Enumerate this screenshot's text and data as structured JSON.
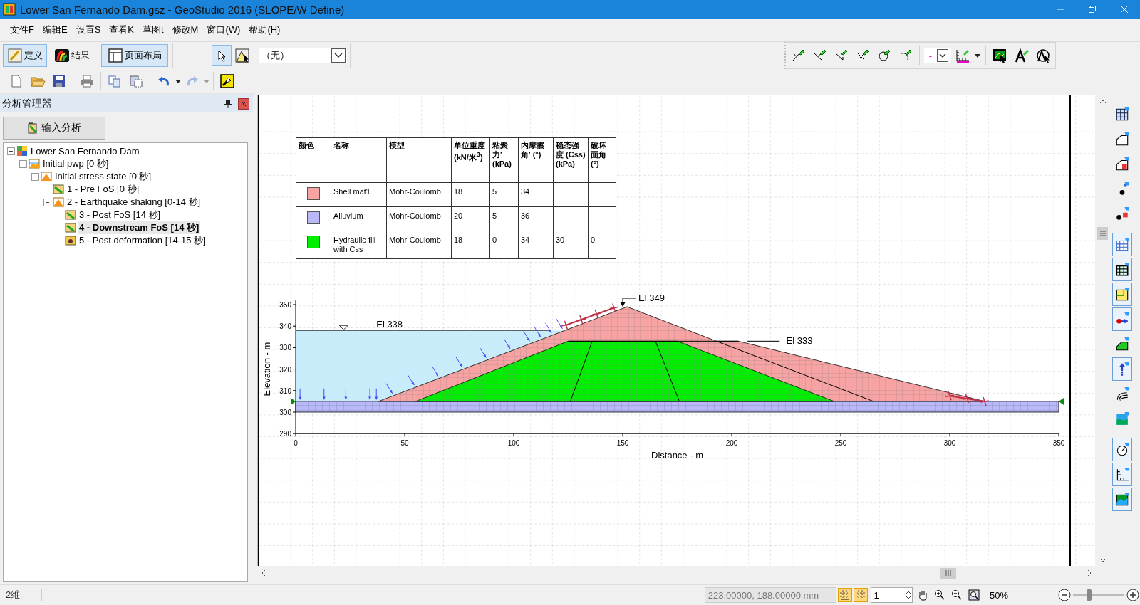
{
  "window": {
    "title": "Lower San Fernando Dam.gsz - GeoStudio 2016 (SLOPE/W Define)"
  },
  "menu": [
    "文件F",
    "编辑E",
    "设置S",
    "查看K",
    "草图t",
    "修改M",
    "窗口(W)",
    "帮助(H)"
  ],
  "mode_buttons": [
    {
      "label": "定义",
      "selected": true
    },
    {
      "label": "结果",
      "selected": false
    },
    {
      "label": "页面布局",
      "selected": true
    }
  ],
  "select_tools": [
    {
      "selected": true
    },
    {
      "selected": false
    }
  ],
  "view_dropdown": {
    "value": "（无）"
  },
  "line_style_dropdown": {
    "value": "-"
  },
  "history": {
    "undo_disabled": false,
    "redo_disabled": true
  },
  "analysis_panel": {
    "title": "分析管理器",
    "add_button": "输入分析",
    "tree": [
      {
        "label": "Lower San Fernando Dam",
        "kind": "project",
        "selected": false,
        "expanded": true,
        "children": [
          {
            "label": "Initial pwp [0 秒]",
            "kind": "pwp",
            "selected": false,
            "expanded": true,
            "children": [
              {
                "label": "Initial stress state [0 秒]",
                "kind": "stress",
                "selected": false,
                "expanded": true,
                "children": [
                  {
                    "label": "1 - Pre FoS [0 秒]",
                    "kind": "slope",
                    "selected": false
                  },
                  {
                    "label": "2 - Earthquake shaking [0-14 秒]",
                    "kind": "stress",
                    "selected": false,
                    "expanded": true,
                    "children": [
                      {
                        "label": "3 - Post FoS [14 秒]",
                        "kind": "slope",
                        "selected": false
                      },
                      {
                        "label": "4 - Downstream FoS [14 秒]",
                        "kind": "slope",
                        "selected": true
                      },
                      {
                        "label": "5 - Post deformation [14-15 秒]",
                        "kind": "deformation",
                        "selected": false
                      }
                    ]
                  }
                ]
              }
            ]
          }
        ]
      }
    ]
  },
  "materials_table": {
    "color_column": "颜色",
    "columns": [
      "名称",
      "模型",
      "单位重度 (kN/米$^{3}$)",
      "粘聚力' (kPa)",
      "内摩擦角' (°)",
      "稳态强度 (Css) (kPa)",
      "破坏面角 (°)"
    ],
    "rows": [
      {
        "color": "#f7a3a3",
        "cells": [
          "Shell mat'l",
          "Mohr-Coulomb",
          "18",
          "5",
          "34"
        ]
      },
      {
        "color": "#b9b9f7",
        "cells": [
          "Alluvium",
          "Mohr-Coulomb",
          "20",
          "5",
          "36"
        ]
      },
      {
        "color": "#00ee00",
        "cells": [
          "Hydraulic fill with Css",
          "Mohr-Coulomb",
          "18",
          "0",
          "34",
          "30",
          "0"
        ]
      }
    ]
  },
  "section": {
    "labels": [
      "El 349",
      "El 338",
      "El 333"
    ],
    "y_axis": {
      "title": "Elevation - m",
      "ticks": [
        "350",
        "340",
        "330",
        "320",
        "310",
        "300",
        "290"
      ]
    },
    "x_axis": {
      "title": "Distance - m",
      "ticks": [
        "0",
        "50",
        "100",
        "150",
        "200",
        "250",
        "300",
        "350"
      ]
    }
  },
  "right_toolbar": [
    {
      "selected": false
    },
    {
      "selected": false
    },
    {
      "selected": false
    },
    {
      "selected": false
    },
    {
      "selected": false
    },
    {
      "selected": true
    },
    {
      "selected": true
    },
    {
      "selected": true
    },
    {
      "selected": true
    },
    {
      "selected": false
    },
    {
      "selected": true
    },
    {
      "selected": false
    },
    {
      "selected": false
    },
    {
      "selected": true
    },
    {
      "selected": true
    },
    {
      "selected": true
    }
  ],
  "status_bar": {
    "mode": "2维",
    "coordinates": "223.00000, 188.00000 mm",
    "snap_buttons": [
      {
        "selected": true
      },
      {
        "selected": true
      }
    ],
    "grid_spacing": "1",
    "zoom": "50%",
    "zoom_slider": {
      "level": 0.3
    }
  }
}
